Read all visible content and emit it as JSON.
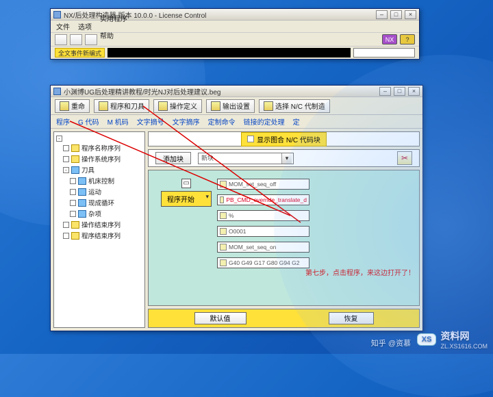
{
  "top_window": {
    "title": "NX/后处理构造器 版本 10.0.0 - License Control",
    "menu": {
      "left": [
        "文件",
        "选项"
      ],
      "right": [
        "实用程序",
        "帮助"
      ]
    },
    "status_chip": "全文事件新编式",
    "nx_badge": "NX"
  },
  "main_window": {
    "title": "小渊博UG后处理精讲教程/时光NJ对后处理建议.beg",
    "toolbar": [
      {
        "label": "重命"
      },
      {
        "label": "程序和刀具"
      },
      {
        "label": "操作定义"
      },
      {
        "label": "输出设置"
      },
      {
        "label": "选择 N/C 代制造"
      }
    ],
    "tabs": [
      "程序",
      "G 代码",
      "M 机码",
      "文字摘号",
      "文字摘序",
      "定制命令",
      "链接的定处理",
      "定"
    ]
  },
  "tree": {
    "items": [
      {
        "label": "程序名称序列",
        "depth": 1,
        "icon": "folder",
        "tw": ""
      },
      {
        "label": "操作系统序列",
        "depth": 1,
        "icon": "folder",
        "tw": ""
      },
      {
        "label": "刀具",
        "depth": 1,
        "icon": "doc",
        "tw": "-"
      },
      {
        "label": "机床控制",
        "depth": 2,
        "icon": "doc",
        "tw": ""
      },
      {
        "label": "运动",
        "depth": 2,
        "icon": "doc",
        "tw": ""
      },
      {
        "label": "现成循环",
        "depth": 2,
        "icon": "doc",
        "tw": ""
      },
      {
        "label": "杂项",
        "depth": 2,
        "icon": "doc",
        "tw": ""
      },
      {
        "label": "操作结束序列",
        "depth": 1,
        "icon": "folder",
        "tw": ""
      },
      {
        "label": "程序结束序列",
        "depth": 1,
        "icon": "folder",
        "tw": ""
      }
    ]
  },
  "header_chip": {
    "sq": "□",
    "text": "显示图合 N/C 代码块"
  },
  "substrip": {
    "add_btn": "添加块",
    "combo_value": "新块"
  },
  "stack": {
    "group_label": "程序开始",
    "fields": [
      {
        "text": "MOM_set_seq_off",
        "neg": false
      },
      {
        "text": "PB_CMD_override_translate_d",
        "neg": true
      },
      {
        "text": "%",
        "neg": false
      },
      {
        "text": "O0001",
        "neg": false
      },
      {
        "text": "MOM_set_seq_on",
        "neg": false
      },
      {
        "text": "G40 G49 G17 G80 G94 G2",
        "neg": false
      }
    ]
  },
  "bottom": {
    "ok": "默认值",
    "cancel": "恢复"
  },
  "annotation": "第七步，点击程序，来这边打开了！",
  "watermark": {
    "zhihu": "知乎 @资慕",
    "brand": "资料网",
    "url": "ZL.XS1616.COM",
    "logo": "XS"
  }
}
